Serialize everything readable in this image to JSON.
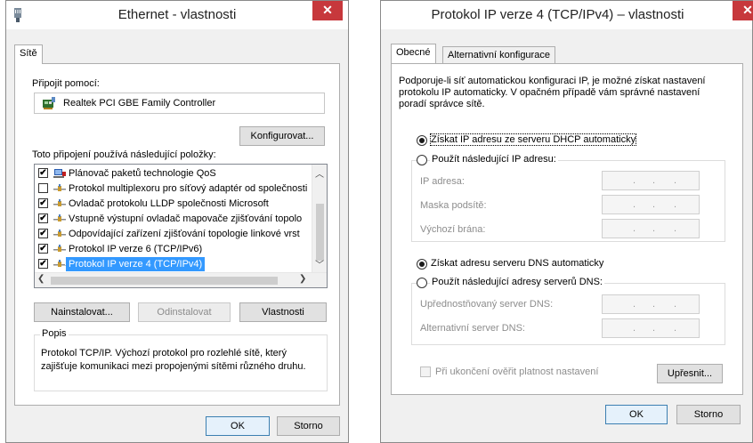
{
  "left_window": {
    "title": "Ethernet - vlastnosti",
    "close_glyph": "✕",
    "tab": "Sítě",
    "connect_using_label": "Připojit pomocí:",
    "adapter_name": "Realtek PCI GBE Family Controller",
    "configure_button": "Konfigurovat...",
    "items_label": "Toto připojení používá následující položky:",
    "items": [
      {
        "label": "Plánovač paketů technologie QoS",
        "checked": true,
        "icon": "qos-icon"
      },
      {
        "label": "Protokol multiplexoru pro síťový adaptér od společnosti",
        "checked": false,
        "icon": "network-protocol-icon"
      },
      {
        "label": "Ovladač protokolu LLDP společnosti Microsoft",
        "checked": true,
        "icon": "network-protocol-icon"
      },
      {
        "label": "Vstupně výstupní ovladač mapovače zjišťování topolo",
        "checked": true,
        "icon": "network-protocol-icon"
      },
      {
        "label": "Odpovídající zařízení zjišťování topologie linkové vrst",
        "checked": true,
        "icon": "network-protocol-icon"
      },
      {
        "label": "Protokol IP verze 6 (TCP/IPv6)",
        "checked": true,
        "icon": "network-protocol-icon"
      },
      {
        "label": "Protokol IP verze 4 (TCP/IPv4)",
        "checked": true,
        "icon": "network-protocol-icon",
        "selected": true
      }
    ],
    "check_glyph": "✔",
    "install_button": "Nainstalovat...",
    "uninstall_button": "Odinstalovat",
    "properties_button": "Vlastnosti",
    "description_group": "Popis",
    "description_line1": "Protokol TCP/IP. Výchozí protokol pro rozlehlé sítě, který",
    "description_line2": "zajišťuje komunikaci mezi propojenými sítěmi různého druhu.",
    "ok_button": "OK",
    "cancel_button": "Storno"
  },
  "right_window": {
    "title": "Protokol IP verze 4 (TCP/IPv4) – vlastnosti",
    "close_glyph": "✕",
    "tab_general": "Obecné",
    "tab_alternate": "Alternativní konfigurace",
    "intro_line1": "Podporuje-li síť automatickou konfiguraci IP, je možné získat nastavení",
    "intro_line2": "protokolu IP automaticky. V opačném případě vám správné nastavení",
    "intro_line3": "poradí správce sítě.",
    "radio_auto_ip": "Získat IP adresu ze serveru DHCP automaticky",
    "radio_manual_ip": "Použít následující IP adresu:",
    "ip_address_label": "IP adresa:",
    "subnet_label": "Maska podsítě:",
    "gateway_label": "Výchozí brána:",
    "radio_auto_dns": "Získat adresu serveru DNS automaticky",
    "radio_manual_dns": "Použít následující adresy serverů DNS:",
    "preferred_dns_label": "Upřednostňovaný server DNS:",
    "alternate_dns_label": "Alternativní server DNS:",
    "validate_checkbox": "Při ukončení ověřit platnost nastavení",
    "advanced_button": "Upřesnit...",
    "ok_button": "OK",
    "cancel_button": "Storno",
    "ip_placeholder_dot": "."
  },
  "colors": {
    "close_red": "#c7383c",
    "selection_blue": "#3399ff",
    "window_bg": "#f0f0f0"
  }
}
